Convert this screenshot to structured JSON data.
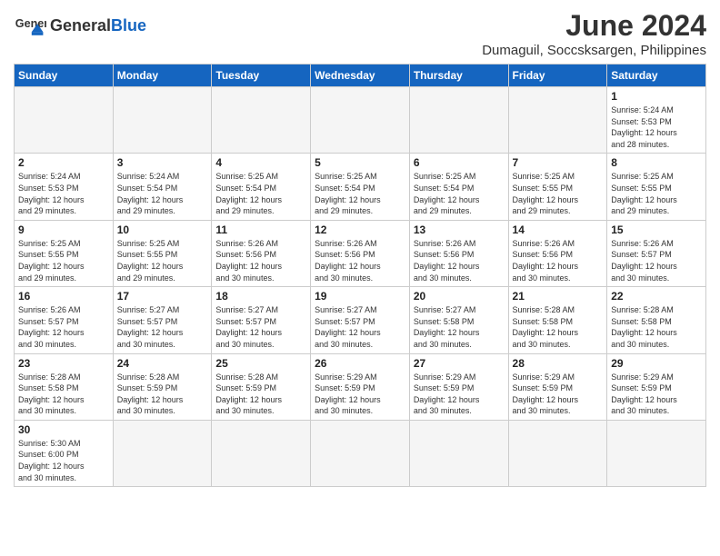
{
  "header": {
    "logo_general": "General",
    "logo_blue": "Blue",
    "month_title": "June 2024",
    "location": "Dumaguil, Soccsksargen, Philippines"
  },
  "weekdays": [
    "Sunday",
    "Monday",
    "Tuesday",
    "Wednesday",
    "Thursday",
    "Friday",
    "Saturday"
  ],
  "weeks": [
    [
      {
        "day": "",
        "info": ""
      },
      {
        "day": "",
        "info": ""
      },
      {
        "day": "",
        "info": ""
      },
      {
        "day": "",
        "info": ""
      },
      {
        "day": "",
        "info": ""
      },
      {
        "day": "",
        "info": ""
      },
      {
        "day": "1",
        "info": "Sunrise: 5:24 AM\nSunset: 5:53 PM\nDaylight: 12 hours\nand 28 minutes."
      }
    ],
    [
      {
        "day": "2",
        "info": "Sunrise: 5:24 AM\nSunset: 5:53 PM\nDaylight: 12 hours\nand 29 minutes."
      },
      {
        "day": "3",
        "info": "Sunrise: 5:24 AM\nSunset: 5:54 PM\nDaylight: 12 hours\nand 29 minutes."
      },
      {
        "day": "4",
        "info": "Sunrise: 5:25 AM\nSunset: 5:54 PM\nDaylight: 12 hours\nand 29 minutes."
      },
      {
        "day": "5",
        "info": "Sunrise: 5:25 AM\nSunset: 5:54 PM\nDaylight: 12 hours\nand 29 minutes."
      },
      {
        "day": "6",
        "info": "Sunrise: 5:25 AM\nSunset: 5:54 PM\nDaylight: 12 hours\nand 29 minutes."
      },
      {
        "day": "7",
        "info": "Sunrise: 5:25 AM\nSunset: 5:55 PM\nDaylight: 12 hours\nand 29 minutes."
      },
      {
        "day": "8",
        "info": "Sunrise: 5:25 AM\nSunset: 5:55 PM\nDaylight: 12 hours\nand 29 minutes."
      }
    ],
    [
      {
        "day": "9",
        "info": "Sunrise: 5:25 AM\nSunset: 5:55 PM\nDaylight: 12 hours\nand 29 minutes."
      },
      {
        "day": "10",
        "info": "Sunrise: 5:25 AM\nSunset: 5:55 PM\nDaylight: 12 hours\nand 29 minutes."
      },
      {
        "day": "11",
        "info": "Sunrise: 5:26 AM\nSunset: 5:56 PM\nDaylight: 12 hours\nand 30 minutes."
      },
      {
        "day": "12",
        "info": "Sunrise: 5:26 AM\nSunset: 5:56 PM\nDaylight: 12 hours\nand 30 minutes."
      },
      {
        "day": "13",
        "info": "Sunrise: 5:26 AM\nSunset: 5:56 PM\nDaylight: 12 hours\nand 30 minutes."
      },
      {
        "day": "14",
        "info": "Sunrise: 5:26 AM\nSunset: 5:56 PM\nDaylight: 12 hours\nand 30 minutes."
      },
      {
        "day": "15",
        "info": "Sunrise: 5:26 AM\nSunset: 5:57 PM\nDaylight: 12 hours\nand 30 minutes."
      }
    ],
    [
      {
        "day": "16",
        "info": "Sunrise: 5:26 AM\nSunset: 5:57 PM\nDaylight: 12 hours\nand 30 minutes."
      },
      {
        "day": "17",
        "info": "Sunrise: 5:27 AM\nSunset: 5:57 PM\nDaylight: 12 hours\nand 30 minutes."
      },
      {
        "day": "18",
        "info": "Sunrise: 5:27 AM\nSunset: 5:57 PM\nDaylight: 12 hours\nand 30 minutes."
      },
      {
        "day": "19",
        "info": "Sunrise: 5:27 AM\nSunset: 5:57 PM\nDaylight: 12 hours\nand 30 minutes."
      },
      {
        "day": "20",
        "info": "Sunrise: 5:27 AM\nSunset: 5:58 PM\nDaylight: 12 hours\nand 30 minutes."
      },
      {
        "day": "21",
        "info": "Sunrise: 5:28 AM\nSunset: 5:58 PM\nDaylight: 12 hours\nand 30 minutes."
      },
      {
        "day": "22",
        "info": "Sunrise: 5:28 AM\nSunset: 5:58 PM\nDaylight: 12 hours\nand 30 minutes."
      }
    ],
    [
      {
        "day": "23",
        "info": "Sunrise: 5:28 AM\nSunset: 5:58 PM\nDaylight: 12 hours\nand 30 minutes."
      },
      {
        "day": "24",
        "info": "Sunrise: 5:28 AM\nSunset: 5:59 PM\nDaylight: 12 hours\nand 30 minutes."
      },
      {
        "day": "25",
        "info": "Sunrise: 5:28 AM\nSunset: 5:59 PM\nDaylight: 12 hours\nand 30 minutes."
      },
      {
        "day": "26",
        "info": "Sunrise: 5:29 AM\nSunset: 5:59 PM\nDaylight: 12 hours\nand 30 minutes."
      },
      {
        "day": "27",
        "info": "Sunrise: 5:29 AM\nSunset: 5:59 PM\nDaylight: 12 hours\nand 30 minutes."
      },
      {
        "day": "28",
        "info": "Sunrise: 5:29 AM\nSunset: 5:59 PM\nDaylight: 12 hours\nand 30 minutes."
      },
      {
        "day": "29",
        "info": "Sunrise: 5:29 AM\nSunset: 5:59 PM\nDaylight: 12 hours\nand 30 minutes."
      }
    ],
    [
      {
        "day": "30",
        "info": "Sunrise: 5:30 AM\nSunset: 6:00 PM\nDaylight: 12 hours\nand 30 minutes."
      },
      {
        "day": "",
        "info": ""
      },
      {
        "day": "",
        "info": ""
      },
      {
        "day": "",
        "info": ""
      },
      {
        "day": "",
        "info": ""
      },
      {
        "day": "",
        "info": ""
      },
      {
        "day": "",
        "info": ""
      }
    ]
  ]
}
